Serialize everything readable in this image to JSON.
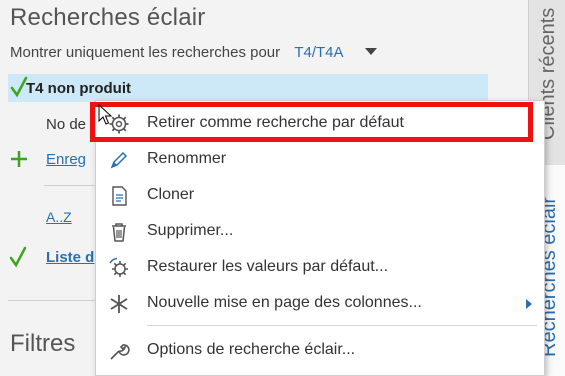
{
  "panel": {
    "title": "Recherches éclair",
    "filter_prefix": "Montrer uniquement les recherches pour",
    "filter_value": "T4/T4A"
  },
  "list": {
    "selected_label": "T4 non produit",
    "plain_label": "No de",
    "add_label": "Enreg",
    "az_label": "A..Z",
    "liste_label": "Liste d"
  },
  "filters_title": "Filtres",
  "right_tabs": {
    "recent": "Clients récents",
    "eclair": "Recherches éclair"
  },
  "menu": {
    "items": [
      {
        "label": "Retirer comme recherche par défaut",
        "icon": "gear-icon"
      },
      {
        "label": "Renommer",
        "icon": "pencil-icon"
      },
      {
        "label": "Cloner",
        "icon": "document-icon"
      },
      {
        "label": "Supprimer...",
        "icon": "trash-icon"
      },
      {
        "label": "Restaurer les valeurs par défaut...",
        "icon": "restore-gear-icon"
      },
      {
        "label": "Nouvelle mise en page des colonnes...",
        "icon": "asterisk-icon"
      },
      {
        "label": "Options de recherche éclair...",
        "icon": "wrench-icon"
      }
    ]
  },
  "colors": {
    "accent": "#2a6fb0",
    "selected_row": "#cde8f7",
    "highlight": "#ee1111",
    "check": "#3aa619"
  }
}
